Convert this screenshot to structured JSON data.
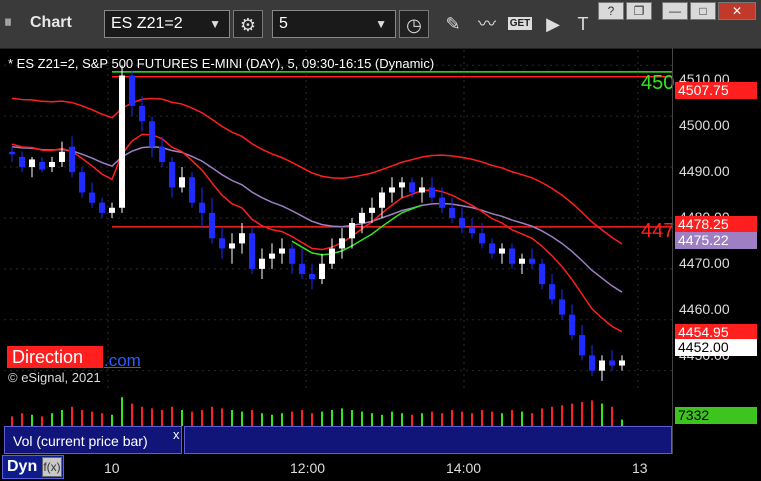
{
  "app": {
    "title": "Chart",
    "grip": "⏸"
  },
  "toolbar": {
    "symbol_value": "ES Z21=2",
    "interval_value": "5",
    "get_label": "GET"
  },
  "window_controls": {
    "help": "?",
    "restore": "❐",
    "minimize": "—",
    "maximize": "□",
    "close": "✕"
  },
  "chart_header": "* ES Z21=2, S&P 500 FUTURES E-MINI (DAY), 5, 09:30-16:15 (Dynamic)",
  "price_axis_labels": [
    "4510.00",
    "4500.00",
    "4490.00",
    "4480.00",
    "4470.00",
    "4460.00",
    "4450.00"
  ],
  "price_tags": {
    "upper_red": "4507.75",
    "line_red": "4478.25",
    "purple": "4475.22",
    "lower_red": "4454.95",
    "last_price": "4452.00",
    "volume": "7332"
  },
  "line_labels": {
    "green_line": "450",
    "red_line": "447"
  },
  "direction_badge": "Direction",
  "link_text": ".com",
  "copyright": "© eSignal, 2021",
  "volume_pane": {
    "label": "Vol (current price bar)",
    "close": "x"
  },
  "time_axis": {
    "labels": [
      "10",
      "12:00",
      "14:00",
      "13"
    ]
  },
  "bottom": {
    "dyn_label": "Dyn",
    "icon": "f(x)"
  },
  "colors": {
    "up_candle": "#ffffff",
    "down_candle": "#1f2bff",
    "ema_fast": "#ff1f1f",
    "band_upper": "#ff1f1f",
    "band_mid": "#9e7fc4",
    "ema_green": "#2ee81f",
    "level_green": "#2ee81f",
    "level_red": "#ff1f1f"
  },
  "chart_data": {
    "type": "candlestick",
    "ylim": [
      4446,
      4513
    ],
    "yticks": [
      4450,
      4460,
      4470,
      4480,
      4490,
      4500,
      4510
    ],
    "horizontal_levels": [
      {
        "name": "green_level",
        "value": 4508.7,
        "color": "#2ee81f"
      },
      {
        "name": "red_level",
        "value": 4507.75,
        "color": "#ff1f1f"
      },
      {
        "name": "red_level_2",
        "value": 4478.25,
        "color": "#ff1f1f"
      }
    ],
    "candles": [
      [
        4493,
        4494,
        4491,
        4492.5
      ],
      [
        4492,
        4493,
        4489,
        4490
      ],
      [
        4490,
        4492,
        4488,
        4491.5
      ],
      [
        4491,
        4492,
        4489,
        4489.5
      ],
      [
        4490,
        4492,
        4489,
        4491
      ],
      [
        4491,
        4495,
        4490,
        4493
      ],
      [
        4494,
        4496,
        4488,
        4489
      ],
      [
        4489,
        4490,
        4484,
        4485
      ],
      [
        4485,
        4487,
        4482,
        4483
      ],
      [
        4483,
        4484,
        4480,
        4481
      ],
      [
        4481,
        4483,
        4480,
        4482
      ],
      [
        4482,
        4510,
        4481,
        4508
      ],
      [
        4508,
        4509,
        4500,
        4502
      ],
      [
        4502,
        4504,
        4497,
        4499
      ],
      [
        4499,
        4500,
        4492,
        4494
      ],
      [
        4494,
        4496,
        4490,
        4491
      ],
      [
        4491,
        4492,
        4484,
        4486
      ],
      [
        4486,
        4490,
        4485,
        4488
      ],
      [
        4488,
        4489,
        4482,
        4483
      ],
      [
        4483,
        4486,
        4478,
        4481
      ],
      [
        4481,
        4484,
        4475,
        4476
      ],
      [
        4476,
        4478,
        4472,
        4474
      ],
      [
        4474,
        4477,
        4471,
        4475
      ],
      [
        4475,
        4479,
        4473,
        4477
      ],
      [
        4477,
        4478,
        4469,
        4470
      ],
      [
        4470,
        4474,
        4468,
        4472
      ],
      [
        4472,
        4475,
        4470,
        4473
      ],
      [
        4473,
        4476,
        4471,
        4474
      ],
      [
        4474,
        4475,
        4469,
        4471
      ],
      [
        4471,
        4474,
        4468,
        4469
      ],
      [
        4469,
        4471,
        4466,
        4468
      ],
      [
        4468,
        4473,
        4467,
        4471
      ],
      [
        4471,
        4476,
        4470,
        4474
      ],
      [
        4474,
        4478,
        4472,
        4476
      ],
      [
        4476,
        4480,
        4474,
        4479
      ],
      [
        4479,
        4482,
        4477,
        4481
      ],
      [
        4481,
        4484,
        4479,
        4482
      ],
      [
        4482,
        4486,
        4480,
        4485
      ],
      [
        4485,
        4488,
        4483,
        4486
      ],
      [
        4486,
        4488,
        4484,
        4487
      ],
      [
        4487,
        4488,
        4484,
        4485
      ],
      [
        4485,
        4488,
        4483,
        4486
      ],
      [
        4486,
        4488,
        4483,
        4484
      ],
      [
        4484,
        4486,
        4481,
        4482
      ],
      [
        4482,
        4484,
        4479,
        4480
      ],
      [
        4480,
        4482,
        4477,
        4478
      ],
      [
        4478,
        4480,
        4476,
        4477
      ],
      [
        4477,
        4479,
        4474,
        4475
      ],
      [
        4475,
        4476,
        4472,
        4473
      ],
      [
        4473,
        4475,
        4471,
        4474
      ],
      [
        4474,
        4475,
        4470,
        4471
      ],
      [
        4471,
        4473,
        4469,
        4472
      ],
      [
        4472,
        4474,
        4470,
        4471
      ],
      [
        4471,
        4472,
        4466,
        4467
      ],
      [
        4467,
        4469,
        4463,
        4464
      ],
      [
        4464,
        4466,
        4460,
        4461
      ],
      [
        4461,
        4463,
        4456,
        4457
      ],
      [
        4457,
        4459,
        4452,
        4453
      ],
      [
        4453,
        4455,
        4449,
        4450
      ],
      [
        4450,
        4453,
        4448,
        4452
      ],
      [
        4452,
        4454,
        4450,
        4451
      ],
      [
        4451,
        4453,
        4450,
        4452
      ]
    ],
    "volume": [
      0.3,
      0.4,
      0.35,
      0.3,
      0.4,
      0.5,
      0.6,
      0.5,
      0.45,
      0.4,
      0.35,
      0.9,
      0.7,
      0.6,
      0.55,
      0.5,
      0.6,
      0.5,
      0.45,
      0.5,
      0.6,
      0.55,
      0.5,
      0.45,
      0.5,
      0.4,
      0.35,
      0.4,
      0.45,
      0.5,
      0.4,
      0.45,
      0.5,
      0.55,
      0.5,
      0.45,
      0.4,
      0.35,
      0.45,
      0.4,
      0.35,
      0.4,
      0.45,
      0.4,
      0.5,
      0.45,
      0.4,
      0.5,
      0.45,
      0.4,
      0.5,
      0.45,
      0.4,
      0.55,
      0.6,
      0.65,
      0.7,
      0.75,
      0.8,
      0.7,
      0.6,
      0.2
    ]
  }
}
